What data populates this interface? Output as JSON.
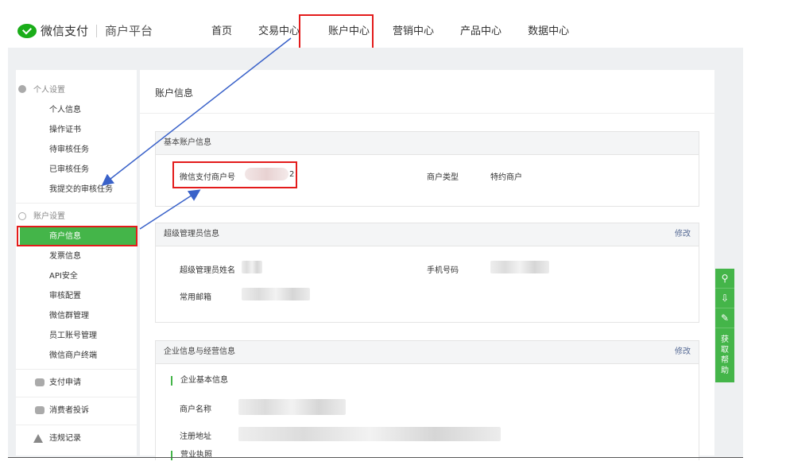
{
  "header": {
    "brand": "微信支付",
    "subbrand": "商户平台",
    "nav": [
      "首页",
      "交易中心",
      "账户中心",
      "营销中心",
      "产品中心",
      "数据中心"
    ],
    "active_nav": "账户中心"
  },
  "sidebar": {
    "personal_title": "个人设置",
    "personal_items": [
      "个人信息",
      "操作证书",
      "待审核任务",
      "已审核任务",
      "我提交的审核任务"
    ],
    "account_title": "账户设置",
    "account_items": [
      "商户信息",
      "发票信息",
      "API安全",
      "审核配置",
      "微信群管理",
      "员工账号管理",
      "微信商户终端"
    ],
    "active_item": "商户信息",
    "bottom_items": [
      "支付申请",
      "消费者投诉",
      "违规记录"
    ]
  },
  "main": {
    "title": "账户信息",
    "basic": {
      "header": "基本账户信息",
      "merchant_id_label": "微信支付商户号",
      "merchant_id_tail": "2",
      "merchant_type_label": "商户类型",
      "merchant_type_value": "特约商户"
    },
    "admin": {
      "header": "超级管理员信息",
      "edit": "修改",
      "name_label": "超级管理员姓名",
      "phone_label": "手机号码",
      "email_label": "常用邮箱"
    },
    "company": {
      "header": "企业信息与经营信息",
      "edit": "修改",
      "sub_header": "企业基本信息",
      "name_label": "商户名称",
      "address_label": "注册地址",
      "license_label": "营业执照"
    }
  },
  "float_bar": {
    "help_chars": [
      "获",
      "取",
      "帮",
      "助"
    ],
    "icons": [
      "link-icon",
      "download-icon",
      "edit-icon"
    ]
  },
  "colors": {
    "accent_green": "#44b549",
    "highlight_red": "#e31b1b",
    "arrow_blue": "#3a62c9",
    "link_blue": "#576b95"
  }
}
